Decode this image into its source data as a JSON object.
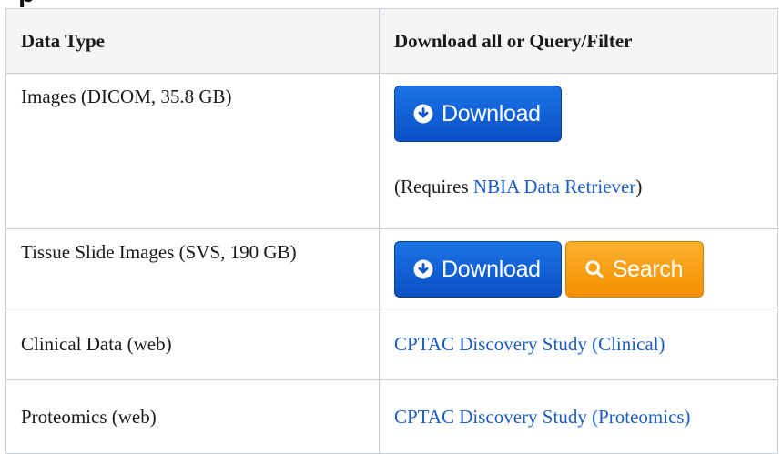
{
  "page": {
    "heading_fragment": "p"
  },
  "table": {
    "headers": [
      "Data Type",
      "Download all or Query/Filter"
    ],
    "rows": [
      {
        "label": "Images (DICOM,  35.8 GB)",
        "download_label": "Download",
        "note_prefix": "(Requires ",
        "note_link": "NBIA Data Retriever",
        "note_suffix": ")"
      },
      {
        "label": "Tissue Slide Images (SVS, 190 GB)",
        "download_label": "Download",
        "search_label": "Search"
      },
      {
        "label": "Clinical Data (web)",
        "link": "CPTAC Discovery Study (Clinical)"
      },
      {
        "label": "Proteomics (web)",
        "link": "CPTAC Discovery Study (Proteomics)"
      }
    ]
  },
  "colors": {
    "download_button": "#1466d8",
    "search_button": "#f59b0f",
    "link": "#1b5dc4",
    "header_background": "#f4f5f7"
  },
  "icons": {
    "download": "circle-arrow-down-icon",
    "search": "magnifier-icon"
  }
}
